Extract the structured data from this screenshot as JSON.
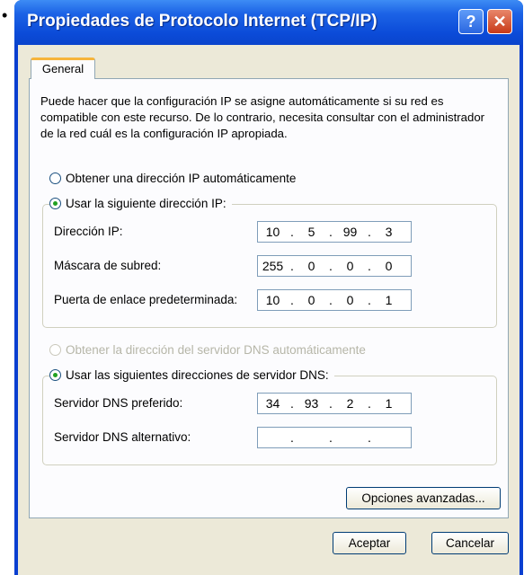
{
  "window": {
    "title": "Propiedades de Protocolo Internet (TCP/IP)",
    "help_glyph": "?",
    "close_glyph": "✕"
  },
  "bullet": "•",
  "tabs": [
    {
      "label": "General"
    }
  ],
  "description": "Puede hacer que la configuración IP se asigne automáticamente si su red es compatible con este recurso. De lo contrario, necesita consultar con el administrador de la red cuál es la configuración IP apropiada.",
  "ip": {
    "auto_label": "Obtener una dirección IP automáticamente",
    "manual_label": "Usar la siguiente dirección IP:",
    "selected": "manual",
    "fields": [
      {
        "label": "Dirección IP:",
        "octets": [
          "10",
          "5",
          "99",
          "3"
        ]
      },
      {
        "label": "Máscara de subred:",
        "octets": [
          "255",
          "0",
          "0",
          "0"
        ]
      },
      {
        "label": "Puerta de enlace predeterminada:",
        "octets": [
          "10",
          "0",
          "0",
          "1"
        ]
      }
    ]
  },
  "dns": {
    "auto_label": "Obtener la dirección del servidor DNS automáticamente",
    "manual_label": "Usar las siguientes direcciones de servidor DNS:",
    "selected": "manual",
    "fields": [
      {
        "label": "Servidor DNS preferido:",
        "octets": [
          "34",
          "93",
          "2",
          "1"
        ]
      },
      {
        "label": "Servidor DNS alternativo:",
        "octets": [
          "",
          "",
          "",
          ""
        ]
      }
    ]
  },
  "buttons": {
    "advanced": "Opciones avanzadas...",
    "ok": "Aceptar",
    "cancel": "Cancelar"
  }
}
